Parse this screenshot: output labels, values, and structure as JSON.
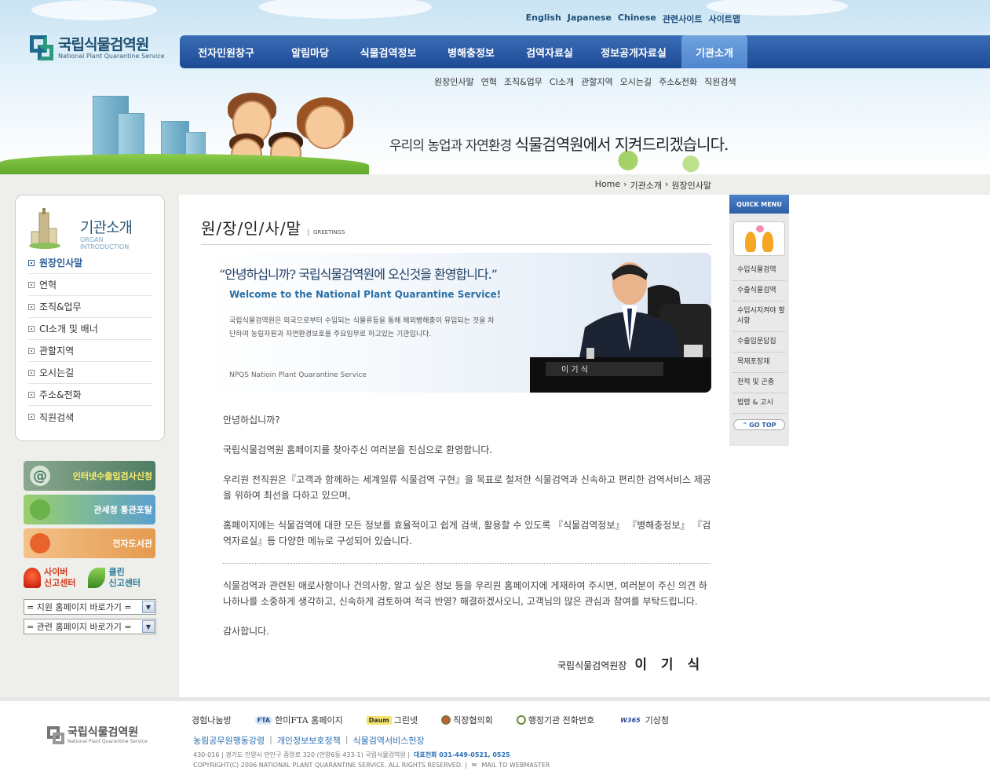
{
  "header": {
    "logo_kor": "국립식물검역원",
    "logo_eng": "National Plant Quarantine Service",
    "top_links": [
      "English",
      "Japanese",
      "Chinese",
      "관련사이트",
      "사이트맵"
    ],
    "gnb": [
      "전자민원창구",
      "알림마당",
      "식물검역정보",
      "병해충정보",
      "검역자료실",
      "정보공개자료실",
      "기관소개"
    ],
    "gnb_active": "기관소개",
    "subnav": [
      "원장인사말",
      "연혁",
      "조직&업무",
      "CI소개",
      "관할지역",
      "오시는길",
      "주소&전화",
      "직원검색"
    ],
    "slogan_pre": "우리의 농업과 자연환경",
    "slogan_main": "식물검역원에서 지켜드리겠습니다."
  },
  "breadcrumb": [
    "Home",
    "기관소개",
    "원장인사말"
  ],
  "sidebar": {
    "title_kor": "기관소개",
    "title_eng": "ORGAN INTRODUCTION",
    "items": [
      "원장인사말",
      "연혁",
      "조직&업무",
      "CI소개 및 배너",
      "관할지역",
      "오시는길",
      "주소&전화",
      "직원검색"
    ],
    "active": "원장인사말",
    "banners": [
      "인터넷수출입검사신청",
      "관세청 통관포탈",
      "전자도서관"
    ],
    "cyber": {
      "left": [
        "사이버",
        "신고센터"
      ],
      "right": [
        "클린",
        "신고센터"
      ]
    },
    "select1": "= 지원 홈페이지 바로가기 =",
    "select2": "= 관련 홈페이지 바로가기 ="
  },
  "content": {
    "title": "원/장/인/사/말",
    "title_eng": "GREETINGS",
    "banner_quote": "“안녕하십니까? 국립식물검역원에 오신것을 환영합니다.”",
    "banner_welcome": "Welcome to the National Plant Quarantine Service!",
    "banner_desc": "국립식물검역원은 외국으로부터 수입되는 식물류등을 통해 해외병해충이 유입되는 것을 차단하여 농림자원과 자연환경보호를 주요임무로 하고있는 기관입니다.",
    "banner_foot": "NPQS Natioin Plant Quarantine Service",
    "paragraphs": [
      "안녕하십니까?",
      "국립식물검역원 홈페이지를 찾아주신 여러분을 진심으로 환영합니다.",
      "우리원 전직원은『고객과 함께하는 세계일류 식물검역 구현』을 목표로 철저한 식물검역과 신속하고 편리한 검역서비스 제공을 위하여 최선을 다하고 있으며,",
      "홈페이지에는 식물검역에 대한 모든 정보를 효율적이고 쉽게 검색, 활용할 수 있도록 『식물검역정보』 『병해충정보』 『검역자료실』등 다양한 메뉴로 구성되어 있습니다."
    ],
    "paragraphs2": [
      "식물검역과 관련된 애로사항이나 건의사항, 알고 싶은 정보 등을 우리원 홈페이지에 게재하여 주시면, 여러분이 주신 의견 하나하나를 소중하게 생각하고, 신속하게 검토하여 적극 반영? 해결하겠사오니, 고객님의 많은 관심과 참여를 부탁드립니다.",
      "감사합니다."
    ],
    "sign_org": "국립식물검역원장",
    "sign_name": "이 기 식"
  },
  "quick_menu": {
    "title": "QUICK MENU",
    "items": [
      "수입식물검역",
      "수출식물검역",
      "수입시지켜야 할 사항",
      "수출입문답집",
      "목재포장재",
      "천적 및 곤충",
      "법령 & 고시"
    ],
    "go_top": "GO TOP"
  },
  "footer": {
    "logo_kor": "국립식물검역원",
    "logo_eng": "National Plant Quarantine Service",
    "links": [
      "경험나눔방",
      "한미FTA 홈페이지",
      "그린넷",
      "직장협의회",
      "행정기관 전화번호",
      "기상청"
    ],
    "fta_badge": "FTA",
    "daum_badge": "Daum",
    "w365_badge": "W365",
    "policy": [
      "농림공무원행동강령",
      "개인정보보호정책",
      "식물검역서비스헌장"
    ],
    "address": "430-016  |  경기도 안양시 만안구 중앙로 320 (안양6동 433-1) 국립식물검역원  |",
    "tel": "대표전화 031-449-0521, 0525",
    "copyright": "COPYRIGHT(C) 2006 NATIONAL PLANT QUARANTINE SERVICE. ALL RIGHTS RESERVED.  |",
    "mail": "MAIL TO WEBMASTER"
  },
  "colors": {
    "gnb": "#1e4a94",
    "gnb_active": "#4f86cf",
    "accent_link": "#2a6fb6"
  }
}
